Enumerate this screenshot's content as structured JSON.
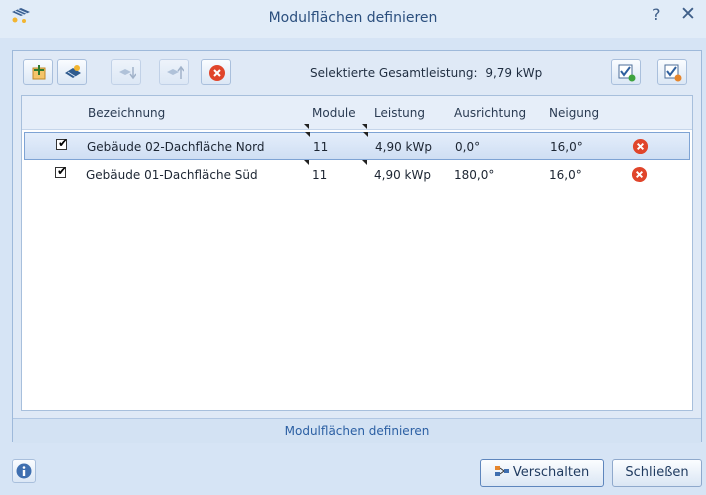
{
  "window": {
    "title": "Modulflächen definieren",
    "help": "?",
    "close": "✕"
  },
  "toolbar": {
    "total_label": "Selektierte Gesamtleistung:",
    "total_value": "9,79 kWp"
  },
  "grid": {
    "columns": [
      "Bezeichnung",
      "Module",
      "Leistung",
      "Ausrichtung",
      "Neigung"
    ],
    "rows": [
      {
        "checked": "✔",
        "name": "Gebäude 02-Dachfläche Nord",
        "module": "11",
        "leistung": "4,90 kWp",
        "ausrichtung": "0,0°",
        "neigung": "16,0°"
      },
      {
        "checked": "✔",
        "name": "Gebäude 01-Dachfläche Süd",
        "module": "11",
        "leistung": "4,90 kWp",
        "ausrichtung": "180,0°",
        "neigung": "16,0°"
      }
    ],
    "footer": "Modulflächen definieren"
  },
  "buttons": {
    "verschalten": "Verschalten",
    "schliessen": "Schließen"
  },
  "colors": {
    "accent": "#2b4f7e",
    "delete_red": "#e0452b",
    "selection": "#cfdef3"
  }
}
